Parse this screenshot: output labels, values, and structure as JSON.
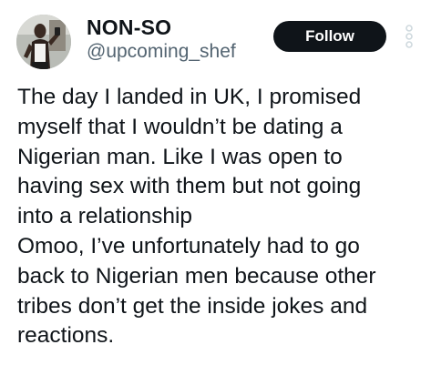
{
  "tweet": {
    "author": {
      "display_name": "NON-SO",
      "handle": "@upcoming_shef"
    },
    "follow_label": "Follow",
    "more_icon": "more-vertical-icon",
    "body_lines": [
      "The day I landed in UK, I promised",
      "myself that I wouldn’t be dating a",
      "Nigerian man. Like I was open to",
      "having sex with them but not going",
      "into a relationship",
      "Omoo, I’ve unfortunately had to go",
      "back to Nigerian men because other",
      "tribes don’t get the inside jokes and",
      "reactions."
    ]
  },
  "colors": {
    "text_primary": "#0f1419",
    "text_secondary": "#536471",
    "follow_bg": "#0f1419",
    "follow_text": "#ffffff",
    "more_icon": "#cfd9de"
  }
}
